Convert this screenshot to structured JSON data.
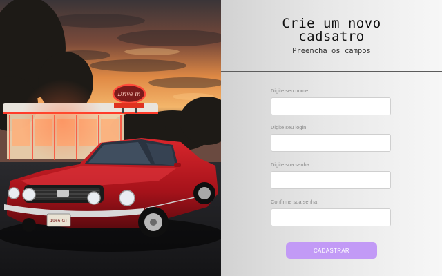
{
  "photo": {
    "sign_text": "Drive In",
    "plate_text": "1966 GT"
  },
  "form": {
    "title": "Crie um novo\ncadsatro",
    "subtitle": "Preencha os campos",
    "fields": [
      {
        "label": "Digite seu nome",
        "value": ""
      },
      {
        "label": "Digite seu login",
        "value": ""
      },
      {
        "label": "Digite sua senha",
        "value": ""
      },
      {
        "label": "Confirme sua senha",
        "value": ""
      }
    ],
    "submit_label": "CADASTRAR"
  },
  "colors": {
    "accent": "#c29af6",
    "divider": "#5c5c5c",
    "car_red": "#b3141c"
  }
}
